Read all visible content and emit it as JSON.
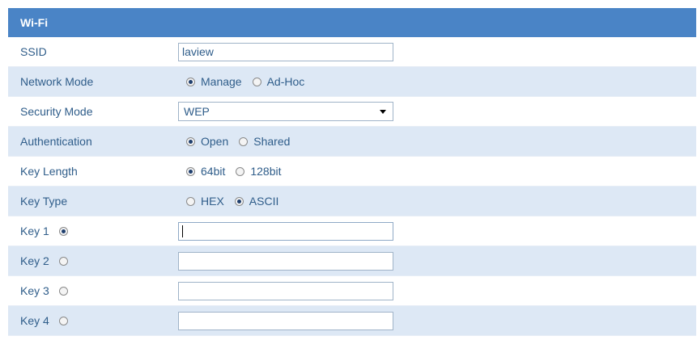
{
  "header": {
    "title": "Wi-Fi"
  },
  "ssid": {
    "label": "SSID",
    "value": "laview"
  },
  "network_mode": {
    "label": "Network Mode",
    "options": [
      "Manage",
      "Ad-Hoc"
    ],
    "selected": "Manage"
  },
  "security_mode": {
    "label": "Security Mode",
    "value": "WEP"
  },
  "authentication": {
    "label": "Authentication",
    "options": [
      "Open",
      "Shared"
    ],
    "selected": "Open"
  },
  "key_length": {
    "label": "Key Length",
    "options": [
      "64bit",
      "128bit"
    ],
    "selected": "64bit"
  },
  "key_type": {
    "label": "Key Type",
    "options": [
      "HEX",
      "ASCII"
    ],
    "selected": "ASCII"
  },
  "keys": [
    {
      "label": "Key 1",
      "selected": true,
      "value": ""
    },
    {
      "label": "Key 2",
      "selected": false,
      "value": ""
    },
    {
      "label": "Key 3",
      "selected": false,
      "value": ""
    },
    {
      "label": "Key 4",
      "selected": false,
      "value": ""
    }
  ],
  "colors": {
    "header_bg": "#4a84c6",
    "alt_row_bg": "#dde8f5",
    "label_text": "#2f5d8a"
  }
}
